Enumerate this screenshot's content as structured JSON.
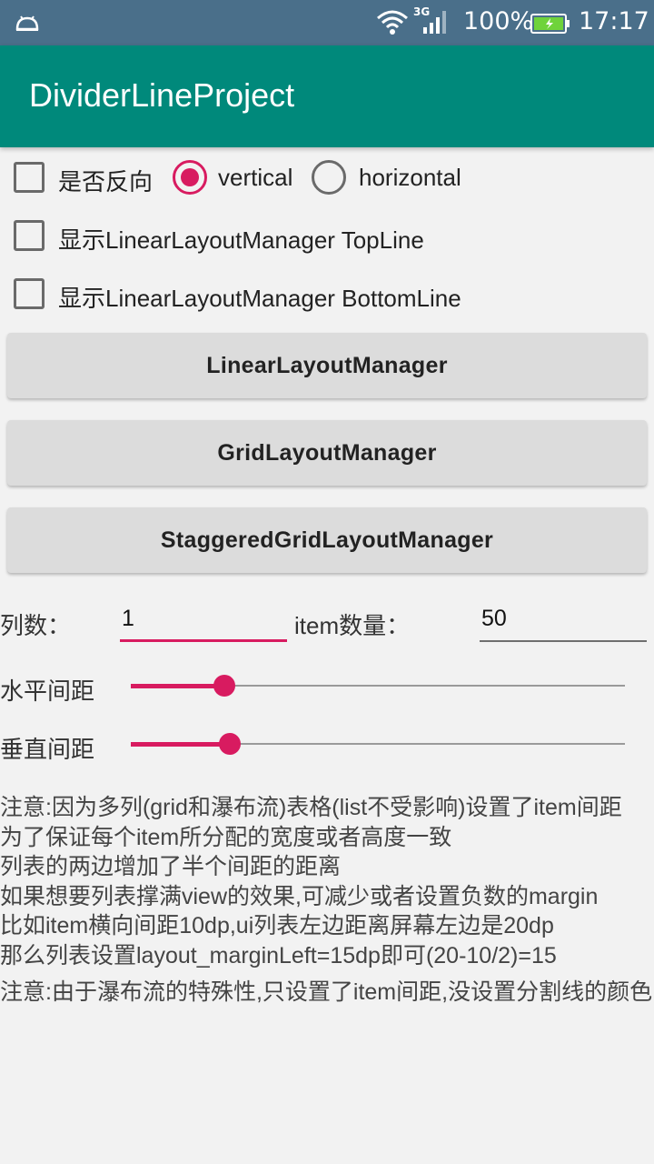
{
  "status_bar": {
    "network": "3G",
    "battery": "100%",
    "time": "17:17"
  },
  "app_bar": {
    "title": "DividerLineProject"
  },
  "options": {
    "reverse_label": "是否反向",
    "orientation": [
      {
        "label": "vertical",
        "selected": true
      },
      {
        "label": "horizontal",
        "selected": false
      }
    ],
    "top_line_label": "显示LinearLayoutManager TopLine",
    "bottom_line_label": "显示LinearLayoutManager BottomLine"
  },
  "buttons": {
    "linear": "LinearLayoutManager",
    "grid": "GridLayoutManager",
    "staggered": "StaggeredGridLayoutManager"
  },
  "fields": {
    "columns_label": "列数：",
    "columns_value": "1",
    "item_count_label": "item数量：",
    "item_count_value": "50"
  },
  "sliders": {
    "horizontal_label": "水平间距",
    "horizontal_fraction": 0.19,
    "vertical_label": "垂直间距",
    "vertical_fraction": 0.2
  },
  "notes": [
    "注意:因为多列(grid和瀑布流)表格(list不受影响)设置了item间距",
    "为了保证每个item所分配的宽度或者高度一致",
    "列表的两边增加了半个间距的距离",
    "如果想要列表撑满view的效果,可减少或者设置负数的margin",
    "比如item横向间距10dp,ui列表左边距离屏幕左边是20dp",
    "那么列表设置layout_marginLeft=15dp即可(20-10/2)=15",
    "注意:由于瀑布流的特殊性,只设置了item间距,没设置分割线的颜色"
  ],
  "colors": {
    "status_bar": "#4a6f8a",
    "app_bar": "#00897b",
    "accent": "#d81b60",
    "button": "#dcdcdc"
  }
}
